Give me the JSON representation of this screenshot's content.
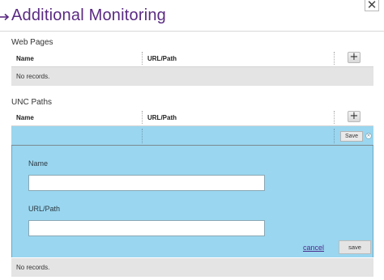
{
  "window": {
    "title": "Additional Monitoring",
    "close_label": "✕"
  },
  "web_pages": {
    "section_title": "Web Pages",
    "columns": {
      "name": "Name",
      "url": "URL/Path"
    },
    "add_label": "+",
    "empty_text": "No records."
  },
  "unc_paths": {
    "section_title": "UNC Paths",
    "columns": {
      "name": "Name",
      "url": "URL/Path"
    },
    "add_label": "+",
    "edit_row": {
      "save_label": "Save",
      "cancel_icon": "×"
    },
    "form": {
      "name_label": "Name",
      "name_value": "",
      "url_label": "URL/Path",
      "url_value": "",
      "cancel_label": "cancel",
      "save_label": "save"
    },
    "empty_text": "No records."
  },
  "colors": {
    "title": "#5a2a82",
    "edit_bg": "#9ad6ef",
    "empty_row_bg": "#e4e4e4",
    "link": "#4b2a8c"
  },
  "icons": {
    "title_arrow": "arrow-right-icon",
    "close": "close-icon",
    "add": "plus-icon",
    "row_cancel": "cancel-circle-icon"
  }
}
